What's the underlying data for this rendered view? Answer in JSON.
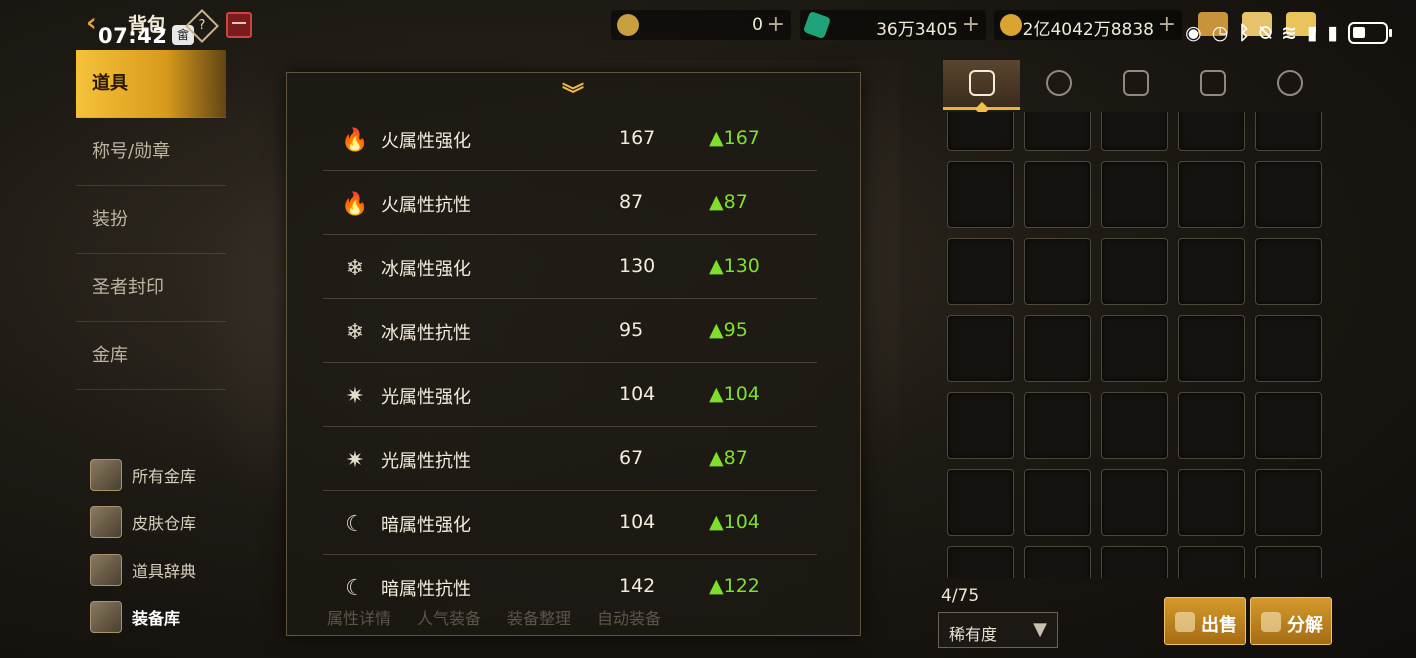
{
  "header": {
    "title": "背包",
    "clock": "07:42",
    "clock_badge": "畲",
    "help_glyph": "?",
    "currencies": [
      {
        "name": "gold-coin-c",
        "value": "0",
        "plus": "+",
        "color": "#c8a040"
      },
      {
        "name": "green-gem",
        "value": "36万3405",
        "plus": "+",
        "color": "#1fa37a"
      },
      {
        "name": "gold-coin",
        "value": "2亿4042万8838",
        "plus": "+",
        "color": "#d9a530"
      }
    ]
  },
  "sidebar": {
    "items": [
      {
        "label": "道具",
        "active": true
      },
      {
        "label": "称号/勋章",
        "active": false
      },
      {
        "label": "装扮",
        "active": false
      },
      {
        "label": "圣者封印",
        "active": false
      },
      {
        "label": "金库",
        "active": false
      }
    ],
    "sub_items": [
      {
        "label": "所有金库",
        "icon": "vault-icon"
      },
      {
        "label": "皮肤仓库",
        "icon": "skin-storage-icon"
      },
      {
        "label": "道具辞典",
        "icon": "item-dictionary-icon"
      },
      {
        "label": "装备库",
        "icon": "equipment-storage-icon",
        "active": true
      }
    ]
  },
  "attributes": {
    "collapse_glyph": "︾",
    "rows": [
      {
        "icon": "fire-enhance-icon",
        "glyph": "🔥",
        "label": "火属性强化",
        "value": "167",
        "change": "▲167"
      },
      {
        "icon": "fire-resist-icon",
        "glyph": "🔥",
        "label": "火属性抗性",
        "value": "87",
        "change": "▲87"
      },
      {
        "icon": "ice-enhance-icon",
        "glyph": "❄",
        "label": "冰属性强化",
        "value": "130",
        "change": "▲130"
      },
      {
        "icon": "ice-resist-icon",
        "glyph": "❄",
        "label": "冰属性抗性",
        "value": "95",
        "change": "▲95"
      },
      {
        "icon": "light-enhance-icon",
        "glyph": "✷",
        "label": "光属性强化",
        "value": "104",
        "change": "▲104"
      },
      {
        "icon": "light-resist-icon",
        "glyph": "✷",
        "label": "光属性抗性",
        "value": "67",
        "change": "▲87"
      },
      {
        "icon": "dark-enhance-icon",
        "glyph": "☾",
        "label": "暗属性强化",
        "value": "104",
        "change": "▲104"
      },
      {
        "icon": "dark-resist-icon",
        "glyph": "☾",
        "label": "暗属性抗性",
        "value": "142",
        "change": "▲122"
      }
    ],
    "footer_tabs": [
      "属性详情",
      "人气装备",
      "装备整理",
      "自动装备"
    ]
  },
  "inventory": {
    "tabs": [
      "equipment-tab-icon",
      "potion-tab-icon",
      "material-tab-icon",
      "card-tab-icon",
      "pentagram-tab-icon"
    ],
    "count": "4/75",
    "rarity_label": "稀有度",
    "rarity_arrow": "▼",
    "sell_label": "出售",
    "disassemble_label": "分解"
  }
}
